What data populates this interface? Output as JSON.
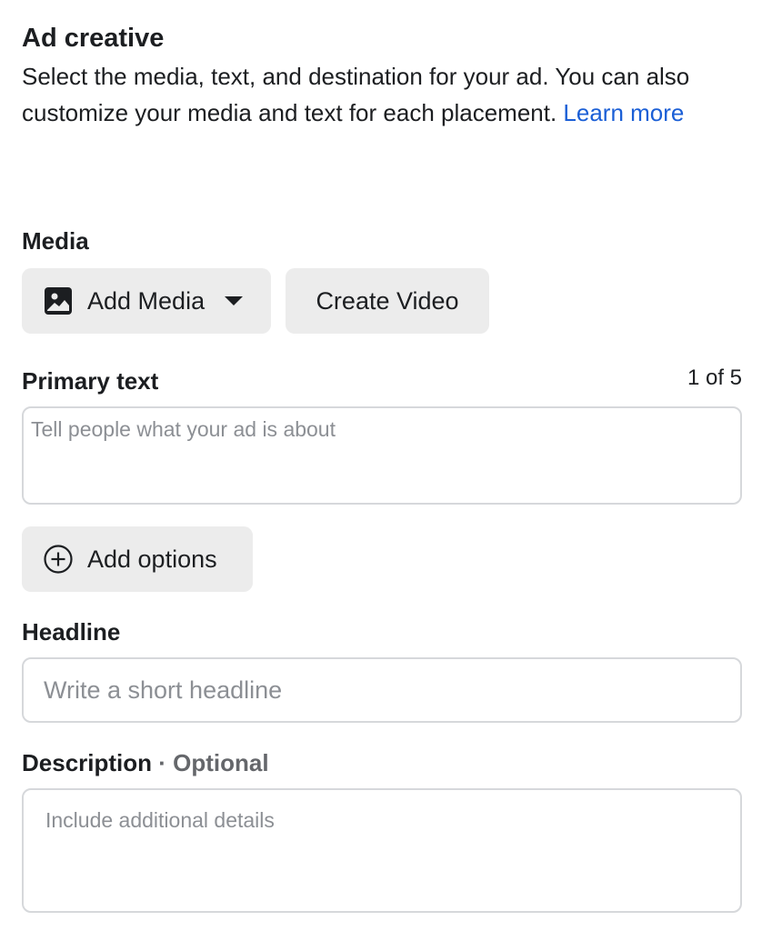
{
  "ad_creative": {
    "title": "Ad creative",
    "intro_text": "Select the media, text, and destination for your ad. You can also customize your media and text for each placement. ",
    "learn_more": "Learn more"
  },
  "media": {
    "label": "Media",
    "add_media_label": "Add Media",
    "add_media_icon": "image-icon",
    "create_video_label": "Create Video"
  },
  "primary_text": {
    "label": "Primary text",
    "counter": "1 of 5",
    "placeholder": "Tell people what your ad is about",
    "value": "",
    "add_options_label": "Add options",
    "add_options_icon": "plus-circle-icon"
  },
  "headline": {
    "label": "Headline",
    "placeholder": "Write a short headline",
    "value": ""
  },
  "description": {
    "label": "Description",
    "optional_suffix": "· Optional",
    "placeholder": "Include additional details",
    "value": ""
  }
}
